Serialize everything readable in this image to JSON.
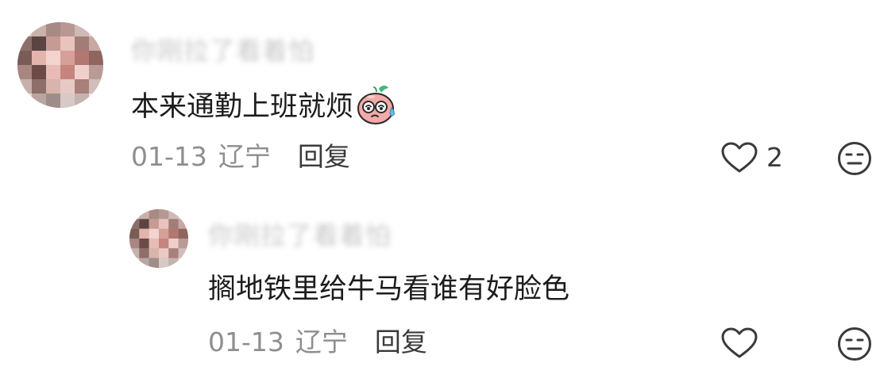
{
  "comment": {
    "username": "你刚拉了看着怕",
    "text": "本来通勤上班就烦",
    "sticker_icon": "sweating-peach-face-icon",
    "date": "01-13",
    "region": "辽宁",
    "reply_label": "回复",
    "like_count": "2",
    "like_icon": "heart-outline-icon",
    "dislike_icon": "meh-face-icon"
  },
  "reply": {
    "username": "你刚拉了看着怕",
    "text": "搁地铁里给牛马看谁有好脸色",
    "date": "01-13",
    "region": "辽宁",
    "reply_label": "回复",
    "like_icon": "heart-outline-icon",
    "dislike_icon": "meh-face-icon"
  },
  "colors": {
    "meta_gray": "#8e8e8e",
    "action_dark": "#3a3a3a",
    "username_blur": "#c7c7c7",
    "text": "#1c1c1c",
    "sticker_pink": "#f2a2a2",
    "sticker_leaf": "#3fb67a",
    "sweat_blue": "#6bbbe8"
  }
}
